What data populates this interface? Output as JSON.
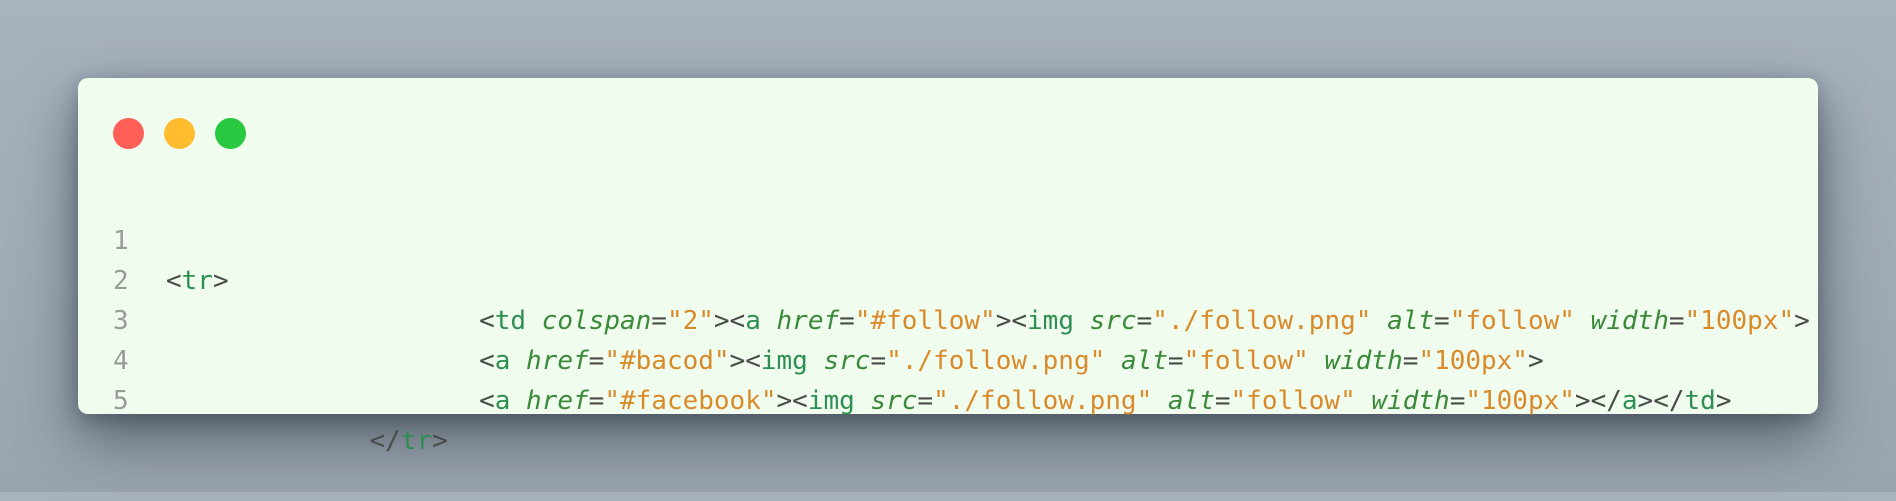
{
  "window": {
    "controls": [
      "close",
      "minimize",
      "maximize"
    ],
    "colors": {
      "close": "#ff5f57",
      "minimize": "#febc2e",
      "maximize": "#28c840",
      "background": "#f0fcee"
    }
  },
  "code": {
    "lines": [
      {
        "number": "1",
        "indent": "",
        "tokens": [
          {
            "t": "punct",
            "v": "<"
          },
          {
            "t": "tag",
            "v": "tr"
          },
          {
            "t": "punct",
            "v": ">"
          }
        ]
      },
      {
        "number": "2",
        "indent": "                    ",
        "tokens": [
          {
            "t": "punct",
            "v": "<"
          },
          {
            "t": "tag",
            "v": "td"
          },
          {
            "t": "punct",
            "v": " "
          },
          {
            "t": "attr",
            "v": "colspan"
          },
          {
            "t": "punct",
            "v": "="
          },
          {
            "t": "str",
            "v": "\"2\""
          },
          {
            "t": "punct",
            "v": "><"
          },
          {
            "t": "tag",
            "v": "a"
          },
          {
            "t": "punct",
            "v": " "
          },
          {
            "t": "attr",
            "v": "href"
          },
          {
            "t": "punct",
            "v": "="
          },
          {
            "t": "str",
            "v": "\"#follow\""
          },
          {
            "t": "punct",
            "v": "><"
          },
          {
            "t": "tag",
            "v": "img"
          },
          {
            "t": "punct",
            "v": " "
          },
          {
            "t": "attr",
            "v": "src"
          },
          {
            "t": "punct",
            "v": "="
          },
          {
            "t": "str",
            "v": "\"./follow.png\""
          },
          {
            "t": "punct",
            "v": " "
          },
          {
            "t": "attr",
            "v": "alt"
          },
          {
            "t": "punct",
            "v": "="
          },
          {
            "t": "str",
            "v": "\"follow\""
          },
          {
            "t": "punct",
            "v": " "
          },
          {
            "t": "attr",
            "v": "width"
          },
          {
            "t": "punct",
            "v": "="
          },
          {
            "t": "str",
            "v": "\"100px\""
          },
          {
            "t": "punct",
            "v": ">"
          }
        ]
      },
      {
        "number": "3",
        "indent": "                    ",
        "tokens": [
          {
            "t": "punct",
            "v": "<"
          },
          {
            "t": "tag",
            "v": "a"
          },
          {
            "t": "punct",
            "v": " "
          },
          {
            "t": "attr",
            "v": "href"
          },
          {
            "t": "punct",
            "v": "="
          },
          {
            "t": "str",
            "v": "\"#bacod\""
          },
          {
            "t": "punct",
            "v": "><"
          },
          {
            "t": "tag",
            "v": "img"
          },
          {
            "t": "punct",
            "v": " "
          },
          {
            "t": "attr",
            "v": "src"
          },
          {
            "t": "punct",
            "v": "="
          },
          {
            "t": "str",
            "v": "\"./follow.png\""
          },
          {
            "t": "punct",
            "v": " "
          },
          {
            "t": "attr",
            "v": "alt"
          },
          {
            "t": "punct",
            "v": "="
          },
          {
            "t": "str",
            "v": "\"follow\""
          },
          {
            "t": "punct",
            "v": " "
          },
          {
            "t": "attr",
            "v": "width"
          },
          {
            "t": "punct",
            "v": "="
          },
          {
            "t": "str",
            "v": "\"100px\""
          },
          {
            "t": "punct",
            "v": ">"
          }
        ]
      },
      {
        "number": "4",
        "indent": "                    ",
        "tokens": [
          {
            "t": "punct",
            "v": "<"
          },
          {
            "t": "tag",
            "v": "a"
          },
          {
            "t": "punct",
            "v": " "
          },
          {
            "t": "attr",
            "v": "href"
          },
          {
            "t": "punct",
            "v": "="
          },
          {
            "t": "str",
            "v": "\"#facebook\""
          },
          {
            "t": "punct",
            "v": "><"
          },
          {
            "t": "tag",
            "v": "img"
          },
          {
            "t": "punct",
            "v": " "
          },
          {
            "t": "attr",
            "v": "src"
          },
          {
            "t": "punct",
            "v": "="
          },
          {
            "t": "str",
            "v": "\"./follow.png\""
          },
          {
            "t": "punct",
            "v": " "
          },
          {
            "t": "attr",
            "v": "alt"
          },
          {
            "t": "punct",
            "v": "="
          },
          {
            "t": "str",
            "v": "\"follow\""
          },
          {
            "t": "punct",
            "v": " "
          },
          {
            "t": "attr",
            "v": "width"
          },
          {
            "t": "punct",
            "v": "="
          },
          {
            "t": "str",
            "v": "\"100px\""
          },
          {
            "t": "punct",
            "v": "></"
          },
          {
            "t": "tag",
            "v": "a"
          },
          {
            "t": "punct",
            "v": "></"
          },
          {
            "t": "tag",
            "v": "td"
          },
          {
            "t": "punct",
            "v": ">"
          }
        ]
      },
      {
        "number": "5",
        "indent": "             ",
        "tokens": [
          {
            "t": "punct",
            "v": "</"
          },
          {
            "t": "tag",
            "v": "tr"
          },
          {
            "t": "punct",
            "v": ">"
          }
        ]
      }
    ]
  }
}
